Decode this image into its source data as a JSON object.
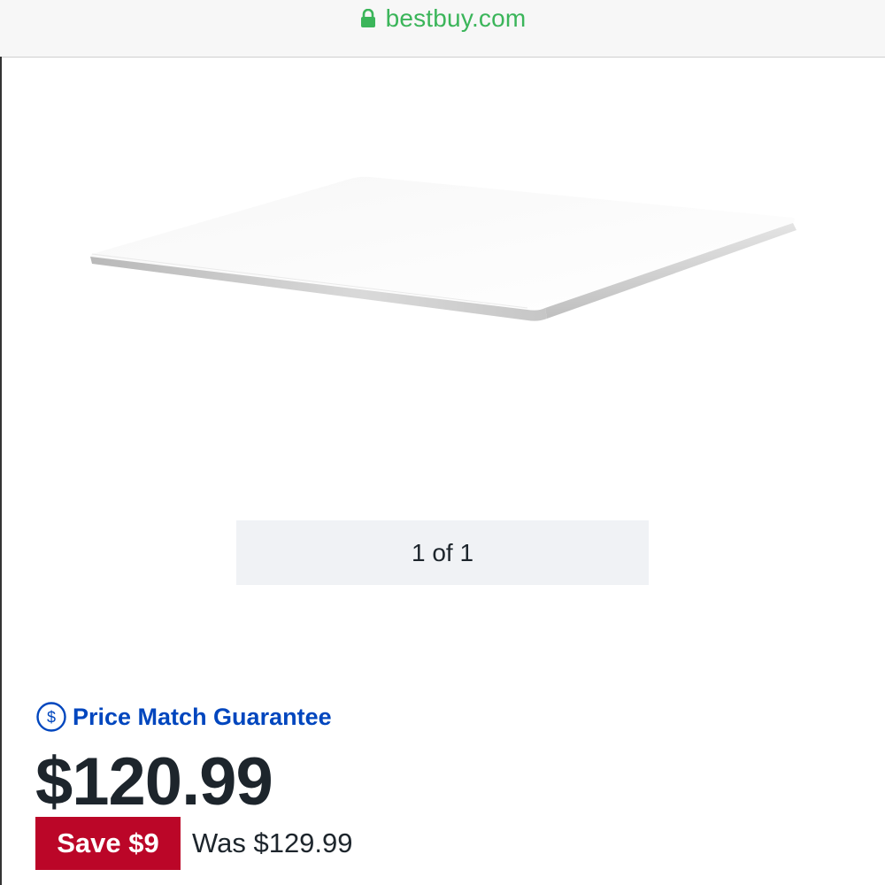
{
  "browser": {
    "url": "bestbuy.com",
    "lock_icon": "lock-icon",
    "url_color": "#3bb55a"
  },
  "product": {
    "image_icon": "trackpad-image",
    "carousel_counter": "1 of 1"
  },
  "pricing": {
    "price_match_icon": "dollar-circle-icon",
    "price_match_label": "Price Match Guarantee",
    "current_price": "$120.99",
    "save_label": "Save $9",
    "was_price": "Was $129.99",
    "brand_blue": "#0046be",
    "save_red": "#bb0628"
  }
}
